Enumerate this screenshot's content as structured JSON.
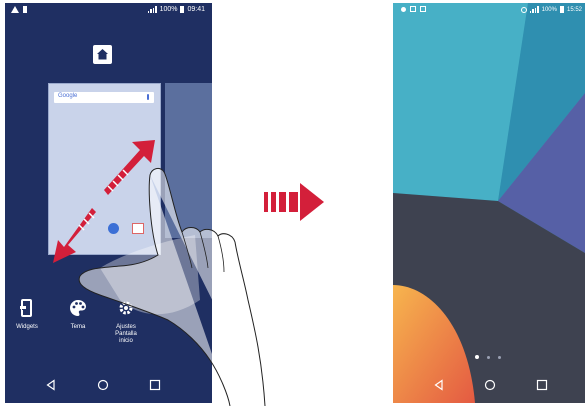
{
  "left_phone": {
    "status_bar": {
      "battery": "100%",
      "time": "09:41"
    },
    "google_bar_label": "Google",
    "bottom_items": [
      {
        "icon": "widgets-icon",
        "label": "Widgets"
      },
      {
        "icon": "palette-icon",
        "label": "Tema"
      },
      {
        "icon": "settings-icon",
        "label": "Ajustes\nPantalla\ninicio"
      }
    ]
  },
  "right_phone": {
    "status_bar": {
      "battery": "100%",
      "time": "15:52"
    },
    "page_indicator": {
      "pages": 3,
      "active": 1
    }
  },
  "colors": {
    "left_bg": "#1f2f62",
    "arrow": "#d31f3a",
    "swipe_arrow": "#d31f3a"
  }
}
